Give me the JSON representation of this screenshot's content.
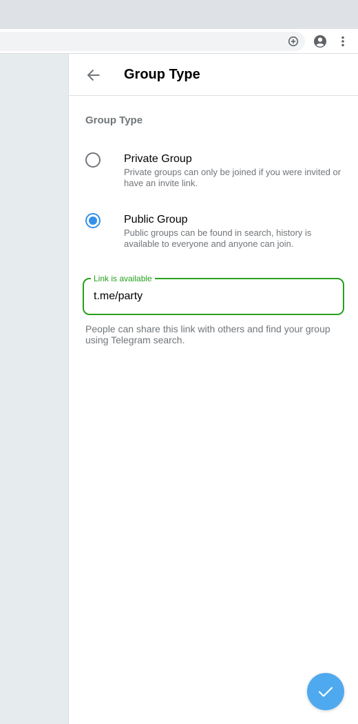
{
  "browser": {
    "toolbar_icons": [
      "zoom-icon",
      "profile-icon",
      "more-vert-icon"
    ]
  },
  "header": {
    "back_icon": "arrow-left-icon",
    "title": "Group Type"
  },
  "section": {
    "title": "Group Type"
  },
  "options": [
    {
      "label": "Private Group",
      "description": "Private groups can only be joined if you were invited or have an invite link.",
      "selected": false
    },
    {
      "label": "Public Group",
      "description": "Public groups can be found in search, history is available to everyone and anyone can join.",
      "selected": true
    }
  ],
  "link_field": {
    "label": "Link is available",
    "value": "t.me/party",
    "status_color": "#26a01c"
  },
  "help_text": "People can share this link with others and find your group using Telegram search.",
  "fab": {
    "icon": "check-icon",
    "color": "#4fa9ee"
  },
  "colors": {
    "accent": "#3390ec",
    "secondary_text": "#707579"
  }
}
